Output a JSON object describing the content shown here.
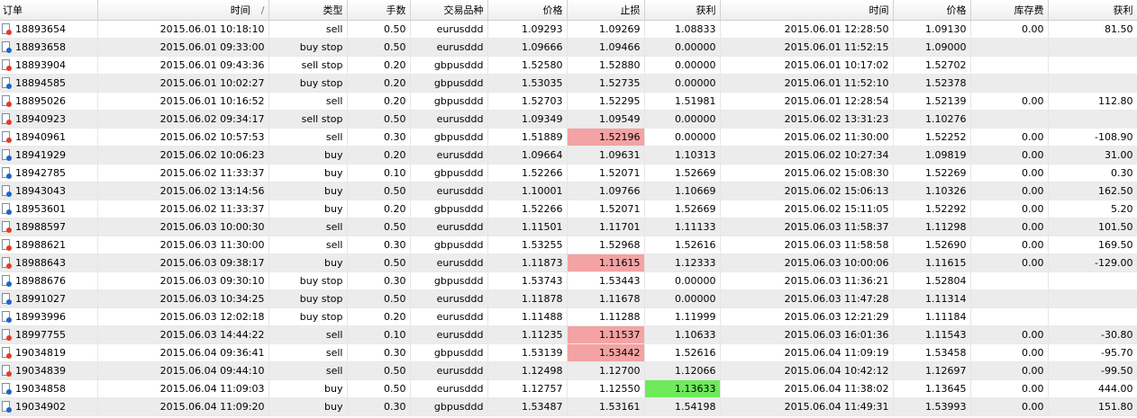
{
  "colors": {
    "sell_dot": "#e23b2b",
    "buy_dot": "#1e64c8",
    "sl_hit": "#f3a3a3",
    "tp_hit": "#6eea5a"
  },
  "header": {
    "order": "订单",
    "open_time": "时间",
    "sort_indicator": "/",
    "type": "类型",
    "lots": "手数",
    "symbol": "交易品种",
    "open_price": "价格",
    "stop_loss": "止损",
    "take_profit": "获利",
    "close_time": "时间",
    "close_price": "价格",
    "swap": "库存费",
    "profit": "获利"
  },
  "rows": [
    {
      "order": "18893654",
      "open_time": "2015.06.01 10:18:10",
      "type": "sell",
      "lots": "0.50",
      "symbol": "eurusddd",
      "open_price": "1.09293",
      "sl": "1.09269",
      "tp": "1.08833",
      "close_time": "2015.06.01 12:28:50",
      "close_price": "1.09130",
      "swap": "0.00",
      "profit": "81.50",
      "icon": "sell",
      "hl": ""
    },
    {
      "order": "18893658",
      "open_time": "2015.06.01 09:33:00",
      "type": "buy stop",
      "lots": "0.50",
      "symbol": "eurusddd",
      "open_price": "1.09666",
      "sl": "1.09466",
      "tp": "0.00000",
      "close_time": "2015.06.01 11:52:15",
      "close_price": "1.09000",
      "swap": "",
      "profit": "",
      "icon": "buy",
      "hl": ""
    },
    {
      "order": "18893904",
      "open_time": "2015.06.01 09:43:36",
      "type": "sell stop",
      "lots": "0.20",
      "symbol": "gbpusddd",
      "open_price": "1.52580",
      "sl": "1.52880",
      "tp": "0.00000",
      "close_time": "2015.06.01 10:17:02",
      "close_price": "1.52702",
      "swap": "",
      "profit": "",
      "icon": "sell",
      "hl": ""
    },
    {
      "order": "18894585",
      "open_time": "2015.06.01 10:02:27",
      "type": "buy stop",
      "lots": "0.20",
      "symbol": "gbpusddd",
      "open_price": "1.53035",
      "sl": "1.52735",
      "tp": "0.00000",
      "close_time": "2015.06.01 11:52:10",
      "close_price": "1.52378",
      "swap": "",
      "profit": "",
      "icon": "buy",
      "hl": ""
    },
    {
      "order": "18895026",
      "open_time": "2015.06.01 10:16:52",
      "type": "sell",
      "lots": "0.20",
      "symbol": "gbpusddd",
      "open_price": "1.52703",
      "sl": "1.52295",
      "tp": "1.51981",
      "close_time": "2015.06.01 12:28:54",
      "close_price": "1.52139",
      "swap": "0.00",
      "profit": "112.80",
      "icon": "sell",
      "hl": ""
    },
    {
      "order": "18940923",
      "open_time": "2015.06.02 09:34:17",
      "type": "sell stop",
      "lots": "0.50",
      "symbol": "eurusddd",
      "open_price": "1.09349",
      "sl": "1.09549",
      "tp": "0.00000",
      "close_time": "2015.06.02 13:31:23",
      "close_price": "1.10276",
      "swap": "",
      "profit": "",
      "icon": "sell",
      "hl": ""
    },
    {
      "order": "18940961",
      "open_time": "2015.06.02 10:57:53",
      "type": "sell",
      "lots": "0.30",
      "symbol": "gbpusddd",
      "open_price": "1.51889",
      "sl": "1.52196",
      "tp": "0.00000",
      "close_time": "2015.06.02 11:30:00",
      "close_price": "1.52252",
      "swap": "0.00",
      "profit": "-108.90",
      "icon": "sell",
      "hl": "sl"
    },
    {
      "order": "18941929",
      "open_time": "2015.06.02 10:06:23",
      "type": "buy",
      "lots": "0.20",
      "symbol": "eurusddd",
      "open_price": "1.09664",
      "sl": "1.09631",
      "tp": "1.10313",
      "close_time": "2015.06.02 10:27:34",
      "close_price": "1.09819",
      "swap": "0.00",
      "profit": "31.00",
      "icon": "buy",
      "hl": ""
    },
    {
      "order": "18942785",
      "open_time": "2015.06.02 11:33:37",
      "type": "buy",
      "lots": "0.10",
      "symbol": "gbpusddd",
      "open_price": "1.52266",
      "sl": "1.52071",
      "tp": "1.52669",
      "close_time": "2015.06.02 15:08:30",
      "close_price": "1.52269",
      "swap": "0.00",
      "profit": "0.30",
      "icon": "buy",
      "hl": ""
    },
    {
      "order": "18943043",
      "open_time": "2015.06.02 13:14:56",
      "type": "buy",
      "lots": "0.50",
      "symbol": "eurusddd",
      "open_price": "1.10001",
      "sl": "1.09766",
      "tp": "1.10669",
      "close_time": "2015.06.02 15:06:13",
      "close_price": "1.10326",
      "swap": "0.00",
      "profit": "162.50",
      "icon": "buy",
      "hl": ""
    },
    {
      "order": "18953601",
      "open_time": "2015.06.02 11:33:37",
      "type": "buy",
      "lots": "0.20",
      "symbol": "gbpusddd",
      "open_price": "1.52266",
      "sl": "1.52071",
      "tp": "1.52669",
      "close_time": "2015.06.02 15:11:05",
      "close_price": "1.52292",
      "swap": "0.00",
      "profit": "5.20",
      "icon": "buy",
      "hl": ""
    },
    {
      "order": "18988597",
      "open_time": "2015.06.03 10:00:30",
      "type": "sell",
      "lots": "0.50",
      "symbol": "eurusddd",
      "open_price": "1.11501",
      "sl": "1.11701",
      "tp": "1.11133",
      "close_time": "2015.06.03 11:58:37",
      "close_price": "1.11298",
      "swap": "0.00",
      "profit": "101.50",
      "icon": "sell",
      "hl": ""
    },
    {
      "order": "18988621",
      "open_time": "2015.06.03 11:30:00",
      "type": "sell",
      "lots": "0.30",
      "symbol": "gbpusddd",
      "open_price": "1.53255",
      "sl": "1.52968",
      "tp": "1.52616",
      "close_time": "2015.06.03 11:58:58",
      "close_price": "1.52690",
      "swap": "0.00",
      "profit": "169.50",
      "icon": "sell",
      "hl": ""
    },
    {
      "order": "18988643",
      "open_time": "2015.06.03 09:38:17",
      "type": "buy",
      "lots": "0.50",
      "symbol": "eurusddd",
      "open_price": "1.11873",
      "sl": "1.11615",
      "tp": "1.12333",
      "close_time": "2015.06.03 10:00:06",
      "close_price": "1.11615",
      "swap": "0.00",
      "profit": "-129.00",
      "icon": "sell",
      "hl": "sl"
    },
    {
      "order": "18988676",
      "open_time": "2015.06.03 09:30:10",
      "type": "buy stop",
      "lots": "0.30",
      "symbol": "gbpusddd",
      "open_price": "1.53743",
      "sl": "1.53443",
      "tp": "0.00000",
      "close_time": "2015.06.03 11:36:21",
      "close_price": "1.52804",
      "swap": "",
      "profit": "",
      "icon": "buy",
      "hl": ""
    },
    {
      "order": "18991027",
      "open_time": "2015.06.03 10:34:25",
      "type": "buy stop",
      "lots": "0.50",
      "symbol": "eurusddd",
      "open_price": "1.11878",
      "sl": "1.11678",
      "tp": "0.00000",
      "close_time": "2015.06.03 11:47:28",
      "close_price": "1.11314",
      "swap": "",
      "profit": "",
      "icon": "buy",
      "hl": ""
    },
    {
      "order": "18993996",
      "open_time": "2015.06.03 12:02:18",
      "type": "buy stop",
      "lots": "0.20",
      "symbol": "eurusddd",
      "open_price": "1.11488",
      "sl": "1.11288",
      "tp": "1.11999",
      "close_time": "2015.06.03 12:21:29",
      "close_price": "1.11184",
      "swap": "",
      "profit": "",
      "icon": "buy",
      "hl": ""
    },
    {
      "order": "18997755",
      "open_time": "2015.06.03 14:44:22",
      "type": "sell",
      "lots": "0.10",
      "symbol": "eurusddd",
      "open_price": "1.11235",
      "sl": "1.11537",
      "tp": "1.10633",
      "close_time": "2015.06.03 16:01:36",
      "close_price": "1.11543",
      "swap": "0.00",
      "profit": "-30.80",
      "icon": "sell",
      "hl": "sl"
    },
    {
      "order": "19034819",
      "open_time": "2015.06.04 09:36:41",
      "type": "sell",
      "lots": "0.30",
      "symbol": "gbpusddd",
      "open_price": "1.53139",
      "sl": "1.53442",
      "tp": "1.52616",
      "close_time": "2015.06.04 11:09:19",
      "close_price": "1.53458",
      "swap": "0.00",
      "profit": "-95.70",
      "icon": "sell",
      "hl": "sl"
    },
    {
      "order": "19034839",
      "open_time": "2015.06.04 09:44:10",
      "type": "sell",
      "lots": "0.50",
      "symbol": "eurusddd",
      "open_price": "1.12498",
      "sl": "1.12700",
      "tp": "1.12066",
      "close_time": "2015.06.04 10:42:12",
      "close_price": "1.12697",
      "swap": "0.00",
      "profit": "-99.50",
      "icon": "sell",
      "hl": ""
    },
    {
      "order": "19034858",
      "open_time": "2015.06.04 11:09:03",
      "type": "buy",
      "lots": "0.50",
      "symbol": "eurusddd",
      "open_price": "1.12757",
      "sl": "1.12550",
      "tp": "1.13633",
      "close_time": "2015.06.04 11:38:02",
      "close_price": "1.13645",
      "swap": "0.00",
      "profit": "444.00",
      "icon": "buy",
      "hl": "tp"
    },
    {
      "order": "19034902",
      "open_time": "2015.06.04 11:09:20",
      "type": "buy",
      "lots": "0.30",
      "symbol": "gbpusddd",
      "open_price": "1.53487",
      "sl": "1.53161",
      "tp": "1.54198",
      "close_time": "2015.06.04 11:49:31",
      "close_price": "1.53993",
      "swap": "0.00",
      "profit": "151.80",
      "icon": "buy",
      "hl": ""
    }
  ]
}
